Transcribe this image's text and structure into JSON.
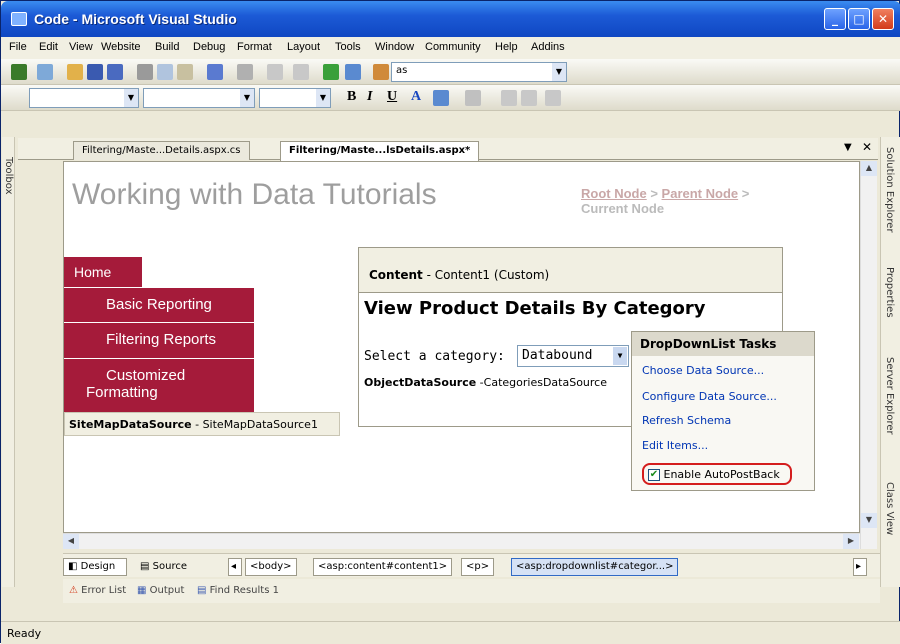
{
  "window": {
    "title": "Code - Microsoft Visual Studio"
  },
  "menubar": [
    "File",
    "Edit",
    "View",
    "Website",
    "Build",
    "Debug",
    "Format",
    "Layout",
    "Tools",
    "Window",
    "Community",
    "Help",
    "Addins"
  ],
  "toolbar": {
    "find_combo_value": "as"
  },
  "format_bar": {
    "bold": "B",
    "italic": "I",
    "underline": "U",
    "font_color": "A"
  },
  "tabs": [
    {
      "label": "Filtering/Maste...Details.aspx.cs"
    },
    {
      "label": "Filtering/Maste...lsDetails.aspx*"
    }
  ],
  "left_panel": {
    "toolbox": "Toolbox"
  },
  "right_panels": [
    "Solution Explorer",
    "Properties",
    "Server Explorer",
    "Class View"
  ],
  "page": {
    "heading": "Working with Data Tutorials",
    "breadcrumb_root": "Root Node",
    "breadcrumb_sep1": " > ",
    "breadcrumb_parent": "Parent Node",
    "breadcrumb_sep2": " >",
    "breadcrumb_current": "Current Node",
    "menu": [
      "Home",
      "Basic Reporting",
      "Filtering Reports",
      "Customized Formatting"
    ],
    "sitemap_ds_bold": "SiteMapDataSource",
    "sitemap_ds_rest": " - SiteMapDataSource1",
    "content_bold": "Content",
    "content_rest": " - Content1 (Custom)",
    "view_title": "View Product Details By Category",
    "select_label": "Select a category:",
    "ddl_value": "Databound",
    "ods_bold": "ObjectDataSource",
    "ods_rest": " -CategoriesDataSource"
  },
  "tasks": {
    "title": "DropDownList Tasks",
    "items": [
      "Choose Data Source...",
      "Configure Data Source...",
      "Refresh Schema",
      "Edit Items..."
    ],
    "checkbox_label": "Enable AutoPostBack",
    "checkbox_checked": true
  },
  "bottom": {
    "design": "Design",
    "source": "Source",
    "crumbs": [
      "<body>",
      "<asp:content#content1>",
      "<p>",
      "<asp:dropdownlist#categor...>"
    ]
  },
  "output_tabs": [
    "Error List",
    "Output",
    "Find Results 1"
  ],
  "status": "Ready"
}
